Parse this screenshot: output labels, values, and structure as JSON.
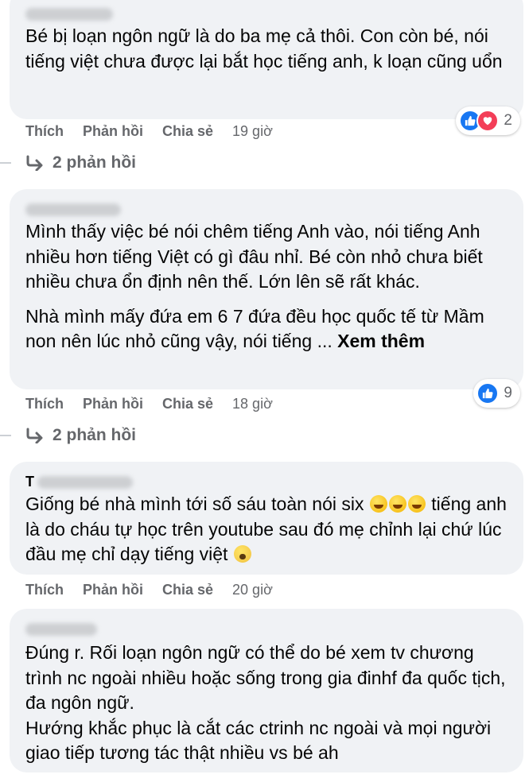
{
  "comments": [
    {
      "author_initial": "",
      "text": "Bé bị loạn ngôn ngữ là do ba mẹ cả thôi. Con còn bé, nói tiếng việt chưa được lại bắt học tiếng anh, k loạn cũng uổn",
      "actions": {
        "like": "Thích",
        "reply": "Phản hồi",
        "share": "Chia sẻ",
        "time": "19 giờ"
      },
      "reactions": {
        "types": [
          "like-icon",
          "love-icon"
        ],
        "count": "2"
      },
      "replies": "2 phản hồi"
    },
    {
      "author_initial": "",
      "text": "Mình thấy việc bé nói chêm tiếng Anh vào, nói tiếng Anh nhiều hơn tiếng Việt có gì đâu nhỉ. Bé còn nhỏ chưa biết nhiều chưa ổn định nên thế. Lớn lên sẽ rất khác.",
      "text2": "Nhà mình mấy đứa em 6 7 đứa đều học quốc tế từ Mầm non nên lúc nhỏ cũng vậy, nói tiếng ...",
      "see_more": "Xem thêm",
      "actions": {
        "like": "Thích",
        "reply": "Phản hồi",
        "share": "Chia sẻ",
        "time": "18 giờ"
      },
      "reactions": {
        "types": [
          "like-icon"
        ],
        "count": "9"
      },
      "replies": "2 phản hồi"
    },
    {
      "author_initial": "T",
      "text_part1": "Giống bé nhà mình tới số sáu toàn nói six ",
      "text_part2": " tiếng anh là do cháu tự học trên youtube sau đó mẹ chỉnh lại chứ lúc đầu mẹ chỉ dạy tiếng việt ",
      "emojis": [
        "grinning-sweat-emoji",
        "grinning-sweat-emoji",
        "grinning-sweat-emoji",
        "fearful-face-emoji"
      ],
      "actions": {
        "like": "Thích",
        "reply": "Phản hồi",
        "share": "Chia sẻ",
        "time": "20 giờ"
      }
    },
    {
      "author_initial": "",
      "text": "Đúng r. Rối loạn ngôn ngữ có thể do bé xem tv chương trình nc ngoài nhiều hoặc sống trong gia đinhf đa quốc tịch, đa ngôn ngữ.\nHướng khắc phục là cắt các ctrinh nc ngoài và mọi người giao tiếp tương tác thật nhiều vs bé ah"
    }
  ],
  "colors": {
    "bubble": "#f0f2f5",
    "meta_text": "#65676b",
    "like_blue": "#1877f2",
    "love_red": "#f33e58"
  }
}
